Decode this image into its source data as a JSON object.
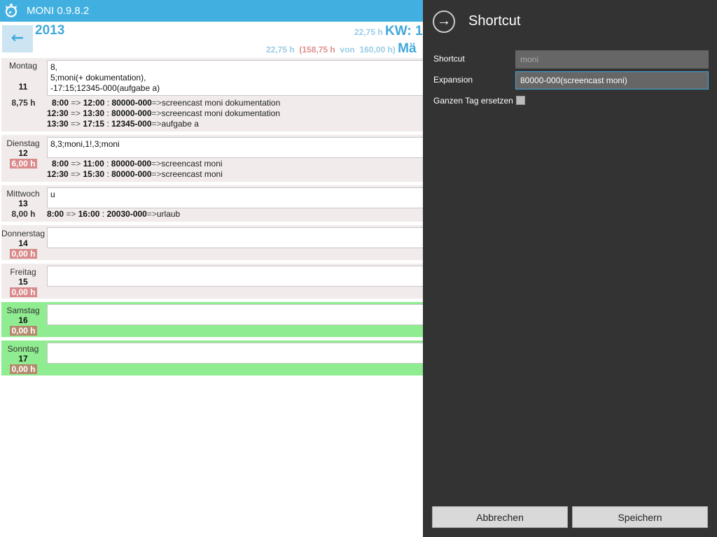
{
  "app": {
    "title": "MONI 0.9.8.2"
  },
  "header": {
    "year": "2013",
    "week_hours": "22,75 h",
    "week_label": "KW: 1",
    "month_hours": "22,75 h",
    "month_total_open": "(158,75 h",
    "month_von": "von",
    "month_target": "160,00 h)",
    "month_label": "Mä"
  },
  "days": [
    {
      "name": "Montag",
      "num": "11",
      "hours": "8,75 h",
      "status": "ok",
      "weekend": false,
      "input": [
        "8,",
        "5;moni(+ dokumentation),",
        "-17:15;12345-000(aufgabe a)"
      ],
      "entries": [
        {
          "from": "8:00",
          "to": "12:00",
          "project": "80000-000",
          "desc": "screencast moni dokumentation"
        },
        {
          "from": "12:30",
          "to": "13:30",
          "project": "80000-000",
          "desc": "screencast moni dokumentation"
        },
        {
          "from": "13:30",
          "to": "17:15",
          "project": "12345-000",
          "desc": "aufgabe a"
        }
      ]
    },
    {
      "name": "Dienstag",
      "num": "12",
      "hours": "6,00 h",
      "status": "under",
      "weekend": false,
      "input": [
        "8,3;moni,1!,3;moni"
      ],
      "entries": [
        {
          "from": "8:00",
          "to": "11:00",
          "project": "80000-000",
          "desc": "screencast moni"
        },
        {
          "from": "12:30",
          "to": "15:30",
          "project": "80000-000",
          "desc": "screencast moni"
        }
      ]
    },
    {
      "name": "Mittwoch",
      "num": "13",
      "hours": "8,00 h",
      "status": "ok",
      "weekend": false,
      "input": [
        "u"
      ],
      "entries": [
        {
          "from": "8:00",
          "to": "16:00",
          "project": "20030-000",
          "desc": "urlaub"
        }
      ]
    },
    {
      "name": "Donnerstag",
      "num": "14",
      "hours": "0,00 h",
      "status": "under",
      "weekend": false,
      "input": [
        ""
      ],
      "entries": []
    },
    {
      "name": "Freitag",
      "num": "15",
      "hours": "0,00 h",
      "status": "under",
      "weekend": false,
      "input": [
        ""
      ],
      "entries": []
    },
    {
      "name": "Samstag",
      "num": "16",
      "hours": "0,00 h",
      "status": "under",
      "weekend": true,
      "input": [
        ""
      ],
      "entries": []
    },
    {
      "name": "Sonntag",
      "num": "17",
      "hours": "0,00 h",
      "status": "under",
      "weekend": true,
      "input": [
        ""
      ],
      "entries": []
    }
  ],
  "arrow": "=>",
  "flyout": {
    "title": "Shortcut",
    "shortcut_label": "Shortcut",
    "shortcut_value": "moni",
    "expansion_label": "Expansion",
    "expansion_value": "80000-000(screencast moni)",
    "replace_day_label": "Ganzen Tag ersetzen",
    "replace_day_checked": false,
    "cancel": "Abbrechen",
    "save": "Speichern"
  },
  "colors": {
    "accent": "#41b0e0",
    "weekend": "#90ec90",
    "under_hours": "#d98a8a",
    "flyout_bg": "#333333"
  }
}
